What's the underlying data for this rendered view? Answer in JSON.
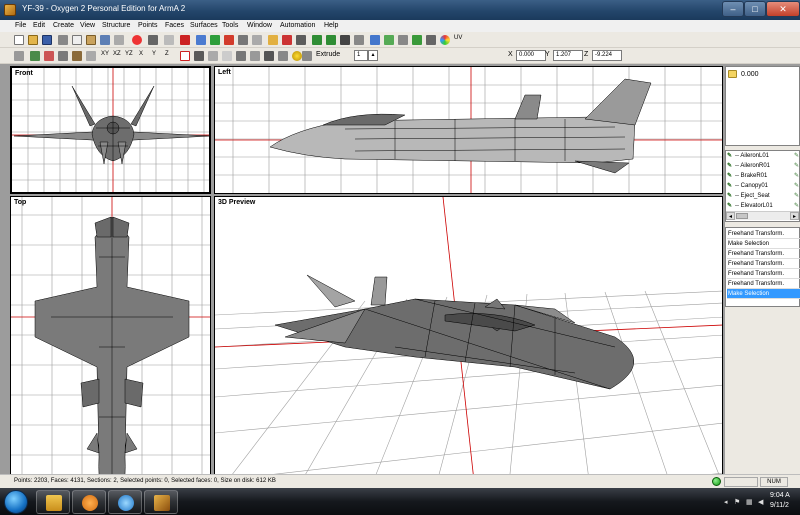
{
  "window": {
    "title": "YF-39 - Oxygen 2 Personal Edition for ArmA 2"
  },
  "menu": {
    "items": [
      "File",
      "Edit",
      "Create",
      "View",
      "Structure",
      "Points",
      "Faces",
      "Surfaces",
      "Tools",
      "Window",
      "Automation",
      "Help"
    ]
  },
  "toolbar2": {
    "axis_labels": [
      "XY",
      "XZ",
      "YZ",
      "X",
      "Y",
      "Z"
    ],
    "extrude_label": "Extrude",
    "extrude_value": "1"
  },
  "toolbar1": {
    "uv_label": "UV"
  },
  "coords": {
    "x_label": "X",
    "x_value": "0.000",
    "y_label": "Y",
    "y_value": "1.207",
    "z_label": "Z",
    "z_value": "-9.224"
  },
  "viewports": {
    "front": "Front",
    "left": "Left",
    "top": "Top",
    "preview": "3D Preview"
  },
  "lod_list": {
    "items": [
      "0.000"
    ]
  },
  "selections": {
    "items": [
      "-- AileronL01",
      "-- AileronR01",
      "-- BrakeR01",
      "-- Canopy01",
      "-- Eject_Seat",
      "-- ElevatorL01"
    ],
    "scroll_left": "◂",
    "scroll_right": "▸"
  },
  "history": {
    "items": [
      "Freehand Transform.",
      "Make Selection",
      "Freehand Transform.",
      "Freehand Transform.",
      "Freehand Transform.",
      "Freehand Transform.",
      "Make Selection"
    ],
    "selected_index": 6
  },
  "status": {
    "text": "Points: 2203, Faces: 4131, Sections: 2, Selected points: 0, Selected faces: 0, Size on disk: 612 KB",
    "num": "NUM"
  },
  "clock": {
    "time": "9:04 A",
    "date": "9/11/2"
  },
  "colors": {
    "titlebar": "#24466b",
    "selection_highlight": "#3399ff",
    "axis_red": "#cc0000",
    "grid": "#9a9a9a",
    "model_fill": "#7a7a7a"
  }
}
